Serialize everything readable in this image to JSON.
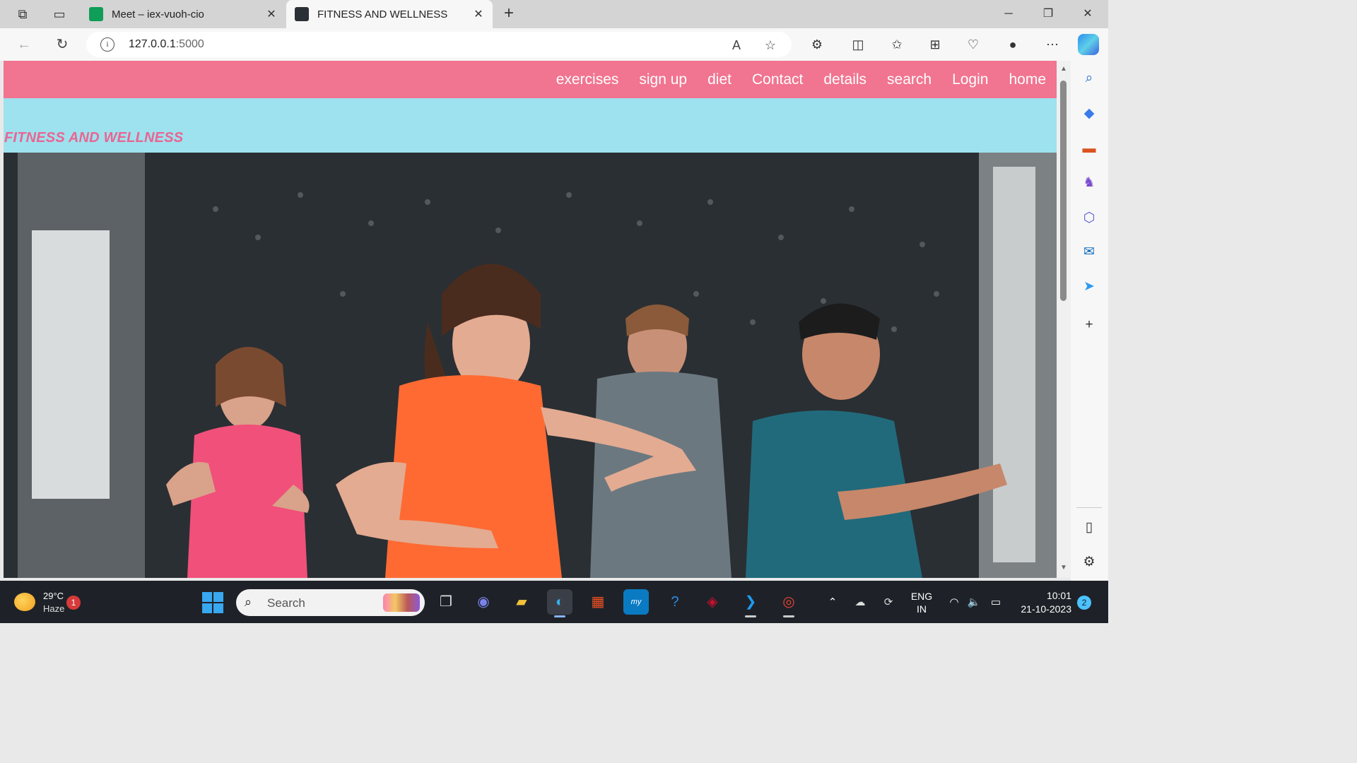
{
  "browser": {
    "tabs": [
      {
        "label": "Meet – iex-vuoh-cio",
        "favicon_color": "#0f9d58",
        "active": false
      },
      {
        "label": "FITNESS AND WELLNESS",
        "favicon_color": "#2b3036",
        "active": true
      }
    ],
    "url_host": "127.0.0.1",
    "url_port": ":5000"
  },
  "site": {
    "nav_items": [
      "exercises",
      "sign up",
      "diet",
      "Contact",
      "details",
      "search",
      "Login",
      "home"
    ],
    "brand": "FITNESS AND WELLNESS",
    "colors": {
      "nav_bg": "#f17490",
      "band_bg": "#9de2ee",
      "brand_text": "#ea6592"
    },
    "hero_image": "group fitness class photo"
  },
  "taskbar": {
    "weather_temp": "29°C",
    "weather_desc": "Haze",
    "weather_badge": "1",
    "search_placeholder": "Search",
    "lang_line1": "ENG",
    "lang_line2": "IN",
    "time": "10:01",
    "date": "21-10-2023",
    "notification_count": "2"
  }
}
